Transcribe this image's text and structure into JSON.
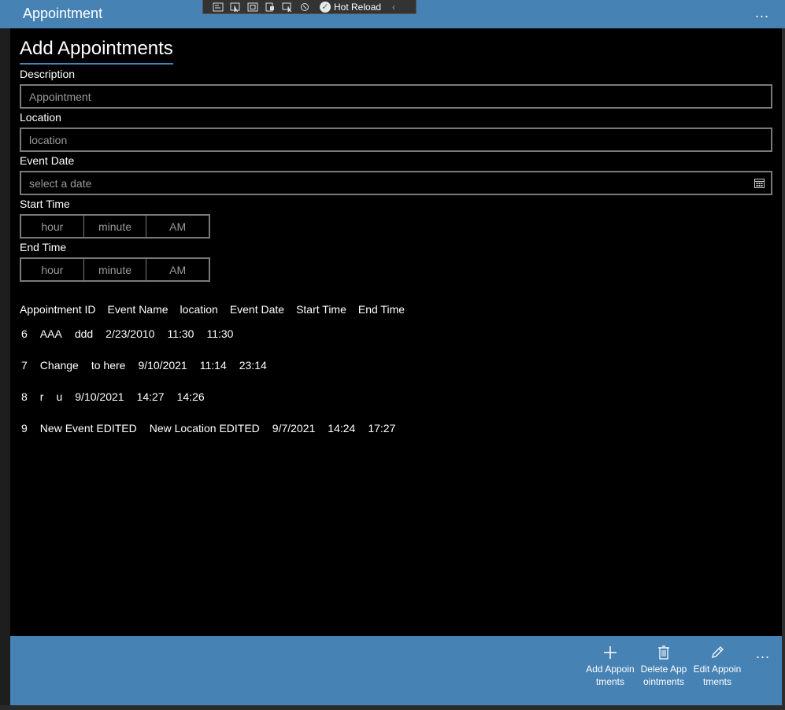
{
  "window": {
    "title": "Appointment",
    "more_label": "..."
  },
  "debug_toolbar": {
    "hot_reload_label": "Hot Reload"
  },
  "page": {
    "heading": "Add Appointments"
  },
  "form": {
    "description": {
      "label": "Description",
      "placeholder": "Appointment"
    },
    "location": {
      "label": "Location",
      "placeholder": "location"
    },
    "event_date": {
      "label": "Event Date",
      "placeholder": "select a date"
    },
    "start_time": {
      "label": "Start Time",
      "hour": "hour",
      "minute": "minute",
      "period": "AM"
    },
    "end_time": {
      "label": "End Time",
      "hour": "hour",
      "minute": "minute",
      "period": "AM"
    }
  },
  "table": {
    "headers": [
      "Appointment ID",
      "Event Name",
      "location",
      "Event Date",
      "Start Time",
      "End Time"
    ],
    "rows": [
      [
        "6",
        "AAA",
        "ddd",
        "2/23/2010",
        "11:30",
        "11:30"
      ],
      [
        "7",
        "Change",
        "to here",
        "9/10/2021",
        "11:14",
        "23:14"
      ],
      [
        "8",
        "r",
        "u",
        "9/10/2021",
        "14:27",
        "14:26"
      ],
      [
        "9",
        "New Event EDITED",
        "New Location EDITED",
        "9/7/2021",
        "14:24",
        "17:27"
      ]
    ]
  },
  "command_bar": {
    "add_label": "Add Appointments",
    "delete_label": "Delete Appointments",
    "edit_label": "Edit Appointments",
    "more_label": "..."
  },
  "colors": {
    "accent": "#4682b4",
    "content_bg": "#000000",
    "border": "#7a7a7a",
    "placeholder": "#9a9a9a"
  }
}
